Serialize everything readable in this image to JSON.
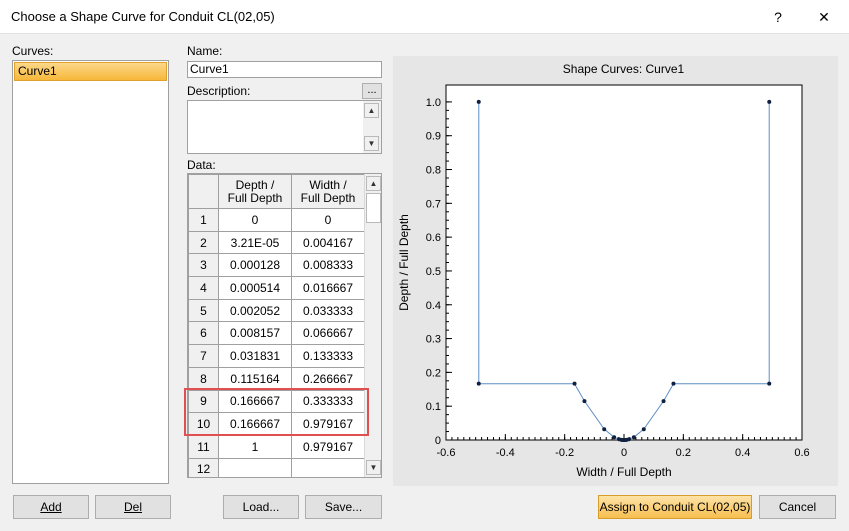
{
  "window": {
    "title": "Choose a Shape Curve for Conduit CL(02,05)",
    "help_label": "?",
    "close_label": "✕"
  },
  "curves": {
    "label": "Curves:",
    "items": [
      "Curve1"
    ]
  },
  "name": {
    "label": "Name:",
    "value": "Curve1"
  },
  "description": {
    "label": "Description:",
    "browse_label": "...",
    "value": ""
  },
  "data": {
    "label": "Data:",
    "columns": [
      "Depth / Full Depth",
      "Width / Full Depth"
    ],
    "column_header_lines": [
      [
        "Depth /",
        "Full Depth"
      ],
      [
        "Width /",
        "Full Depth"
      ]
    ],
    "rows": [
      {
        "n": "1",
        "depth": "0",
        "width": "0"
      },
      {
        "n": "2",
        "depth": "3.21E-05",
        "width": "0.004167"
      },
      {
        "n": "3",
        "depth": "0.000128",
        "width": "0.008333"
      },
      {
        "n": "4",
        "depth": "0.000514",
        "width": "0.016667"
      },
      {
        "n": "5",
        "depth": "0.002052",
        "width": "0.033333"
      },
      {
        "n": "6",
        "depth": "0.008157",
        "width": "0.066667"
      },
      {
        "n": "7",
        "depth": "0.031831",
        "width": "0.133333"
      },
      {
        "n": "8",
        "depth": "0.115164",
        "width": "0.266667"
      },
      {
        "n": "9",
        "depth": "0.166667",
        "width": "0.333333"
      },
      {
        "n": "10",
        "depth": "0.166667",
        "width": "0.979167"
      },
      {
        "n": "11",
        "depth": "1",
        "width": "0.979167"
      },
      {
        "n": "12",
        "depth": "",
        "width": ""
      }
    ]
  },
  "buttons": {
    "add": "Add",
    "del": "Del",
    "load": "Load...",
    "save": "Save...",
    "assign": "Assign to Conduit CL(02,05)",
    "cancel": "Cancel"
  },
  "colors": {
    "line": "#5b8ec4",
    "highlight": "#e05050",
    "selection": "#f7b73a"
  },
  "chart_data": {
    "type": "line",
    "title": "Shape Curves: Curve1",
    "xlabel": "Width / Full Depth",
    "ylabel": "Depth / Full Depth",
    "xlim": [
      -0.6,
      0.6
    ],
    "ylim": [
      0,
      1.05
    ],
    "xticks": [
      "-0.6",
      "-0.4",
      "-0.2",
      "0",
      "0.2",
      "0.4",
      "0.6"
    ],
    "yticks": [
      "0",
      "0.1",
      "0.2",
      "0.3",
      "0.4",
      "0.5",
      "0.6",
      "0.7",
      "0.8",
      "0.9",
      "1.0"
    ],
    "grid": false,
    "series": [
      {
        "x": [
          -0.4896,
          -0.4896,
          -0.1667,
          -0.1333,
          -0.0667,
          -0.0333,
          -0.0167,
          -0.0083,
          -0.0042,
          0,
          0.0042,
          0.0083,
          0.0167,
          0.0333,
          0.0667,
          0.1333,
          0.1667,
          0.4896,
          0.4896
        ],
        "y": [
          1,
          0.166667,
          0.166667,
          0.115164,
          0.031831,
          0.008157,
          0.002052,
          0.000514,
          0.000128,
          0,
          0.000128,
          0.000514,
          0.002052,
          0.008157,
          0.031831,
          0.115164,
          0.166667,
          0.166667,
          1
        ]
      }
    ]
  }
}
